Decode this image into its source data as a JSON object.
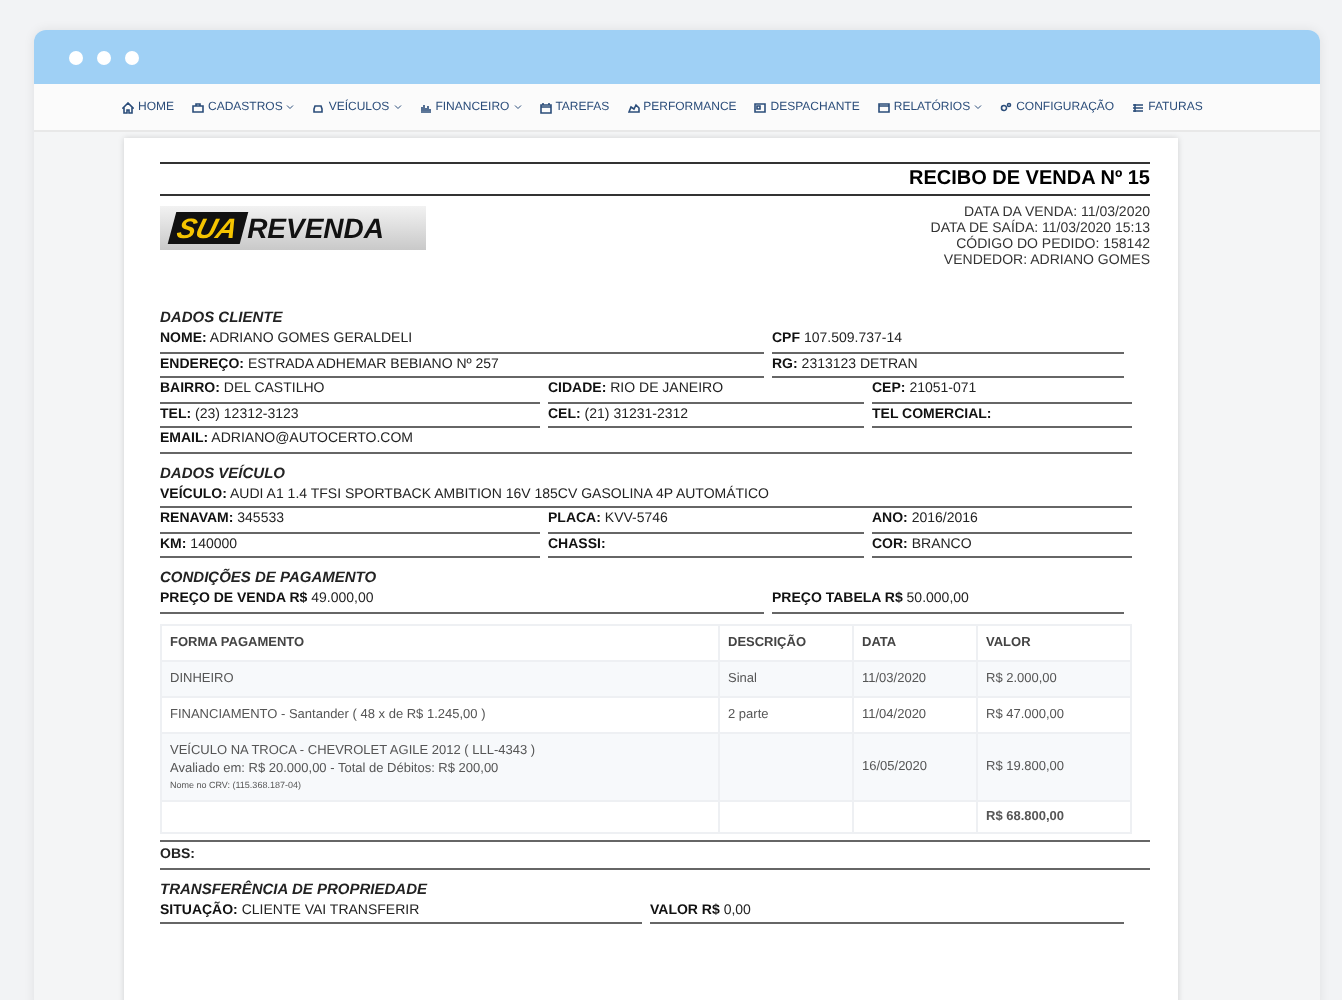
{
  "nav": [
    {
      "label": "HOME",
      "dropdown": false
    },
    {
      "label": "CADASTROS",
      "dropdown": true
    },
    {
      "label": "VEÍCULOS",
      "dropdown": true
    },
    {
      "label": "FINANCEIRO",
      "dropdown": true
    },
    {
      "label": "TAREFAS",
      "dropdown": false
    },
    {
      "label": "PERFORMANCE",
      "dropdown": false
    },
    {
      "label": "DESPACHANTE",
      "dropdown": false
    },
    {
      "label": "RELATÓRIOS",
      "dropdown": true
    },
    {
      "label": "CONFIGURAÇÃO",
      "dropdown": false
    },
    {
      "label": "FATURAS",
      "dropdown": false
    }
  ],
  "receipt": {
    "title": "RECIBO DE VENDA Nº 15",
    "logo": {
      "highlight": "SUA",
      "rest": "REVENDA"
    },
    "info": [
      "DATA DA VENDA: 11/03/2020",
      "DATA DE SAÍDA: 11/03/2020 15:13",
      "CÓDIGO DO PEDIDO: 158142",
      "VENDEDOR: ADRIANO GOMES"
    ],
    "client": {
      "heading": "DADOS CLIENTE",
      "rows": [
        [
          {
            "label": "NOME:",
            "value": "ADRIANO GOMES GERALDELI"
          },
          {
            "label": "CPF",
            "value": "107.509.737-14"
          }
        ],
        [
          {
            "label": "ENDEREÇO:",
            "value": "ESTRADA ADHEMAR BEBIANO Nº 257"
          },
          {
            "label": "RG:",
            "value": "2313123 DETRAN"
          }
        ],
        [
          {
            "label": "BAIRRO:",
            "value": "DEL CASTILHO"
          },
          {
            "label": "CIDADE:",
            "value": "RIO DE JANEIRO"
          },
          {
            "label": "CEP:",
            "value": "21051-071"
          }
        ],
        [
          {
            "label": "TEL:",
            "value": "(23) 12312-3123"
          },
          {
            "label": "CEL:",
            "value": "(21) 31231-2312"
          },
          {
            "label": "TEL COMERCIAL:"
          }
        ],
        [
          {
            "label": "EMAIL:",
            "value": "ADRIANO@AUTOCERTO.COM"
          }
        ]
      ]
    },
    "vehicle": {
      "heading": "DADOS VEÍCULO",
      "rows": [
        [
          {
            "label": "VEÍCULO:",
            "value": "AUDI A1 1.4 TFSI SPORTBACK AMBITION 16V 185CV GASOLINA 4P AUTOMÁTICO"
          }
        ],
        [
          {
            "label": "RENAVAM:",
            "value": "345533"
          },
          {
            "label": "PLACA:",
            "value": "KVV-5746"
          },
          {
            "label": "ANO:",
            "value": "2016/2016"
          }
        ],
        [
          {
            "label": "KM:",
            "value": "140000"
          },
          {
            "label": "CHASSI:"
          },
          {
            "label": "COR:",
            "value": "BRANCO"
          }
        ]
      ]
    },
    "payment": {
      "heading": "CONDIÇÕES DE PAGAMENTO",
      "prices": [
        {
          "label": "PREÇO DE VENDA R$",
          "value": "49.000,00"
        },
        {
          "label": "PREÇO TABELA R$",
          "value": "50.000,00"
        }
      ],
      "columns": [
        "FORMA PAGAMENTO",
        "DESCRIÇÃO",
        "DATA",
        "VALOR"
      ],
      "rows": [
        {
          "forma": [
            {
              "kind": "main",
              "text": "DINHEIRO"
            }
          ],
          "descricao": "Sinal",
          "data": "11/03/2020",
          "valor": "R$ 2.000,00"
        },
        {
          "forma": [
            {
              "kind": "main",
              "text": "FINANCIAMENTO - Santander ( 48 x de R$ 1.245,00 )"
            }
          ],
          "descricao": "2 parte",
          "data": "11/04/2020",
          "valor": "R$ 47.000,00"
        },
        {
          "forma": [
            {
              "kind": "main",
              "text": "VEÍCULO NA TROCA - CHEVROLET AGILE 2012 ( LLL-4343 )"
            },
            {
              "kind": "main",
              "text": "Avaliado em: R$ 20.000,00 - Total de Débitos: R$ 200,00"
            },
            {
              "kind": "note",
              "text": "Nome no CRV: (115.368.187-04)"
            }
          ],
          "data": "16/05/2020",
          "valor": "R$ 19.800,00"
        }
      ],
      "total": "R$ 68.800,00"
    },
    "obs": {
      "label": "OBS:"
    },
    "transfer": {
      "heading": "TRANSFERÊNCIA DE PROPRIEDADE",
      "fields": [
        {
          "label": "SITUAÇÃO:",
          "value": "CLIENTE VAI TRANSFERIR"
        },
        {
          "label": "VALOR R$",
          "value": "0,00"
        }
      ]
    }
  }
}
